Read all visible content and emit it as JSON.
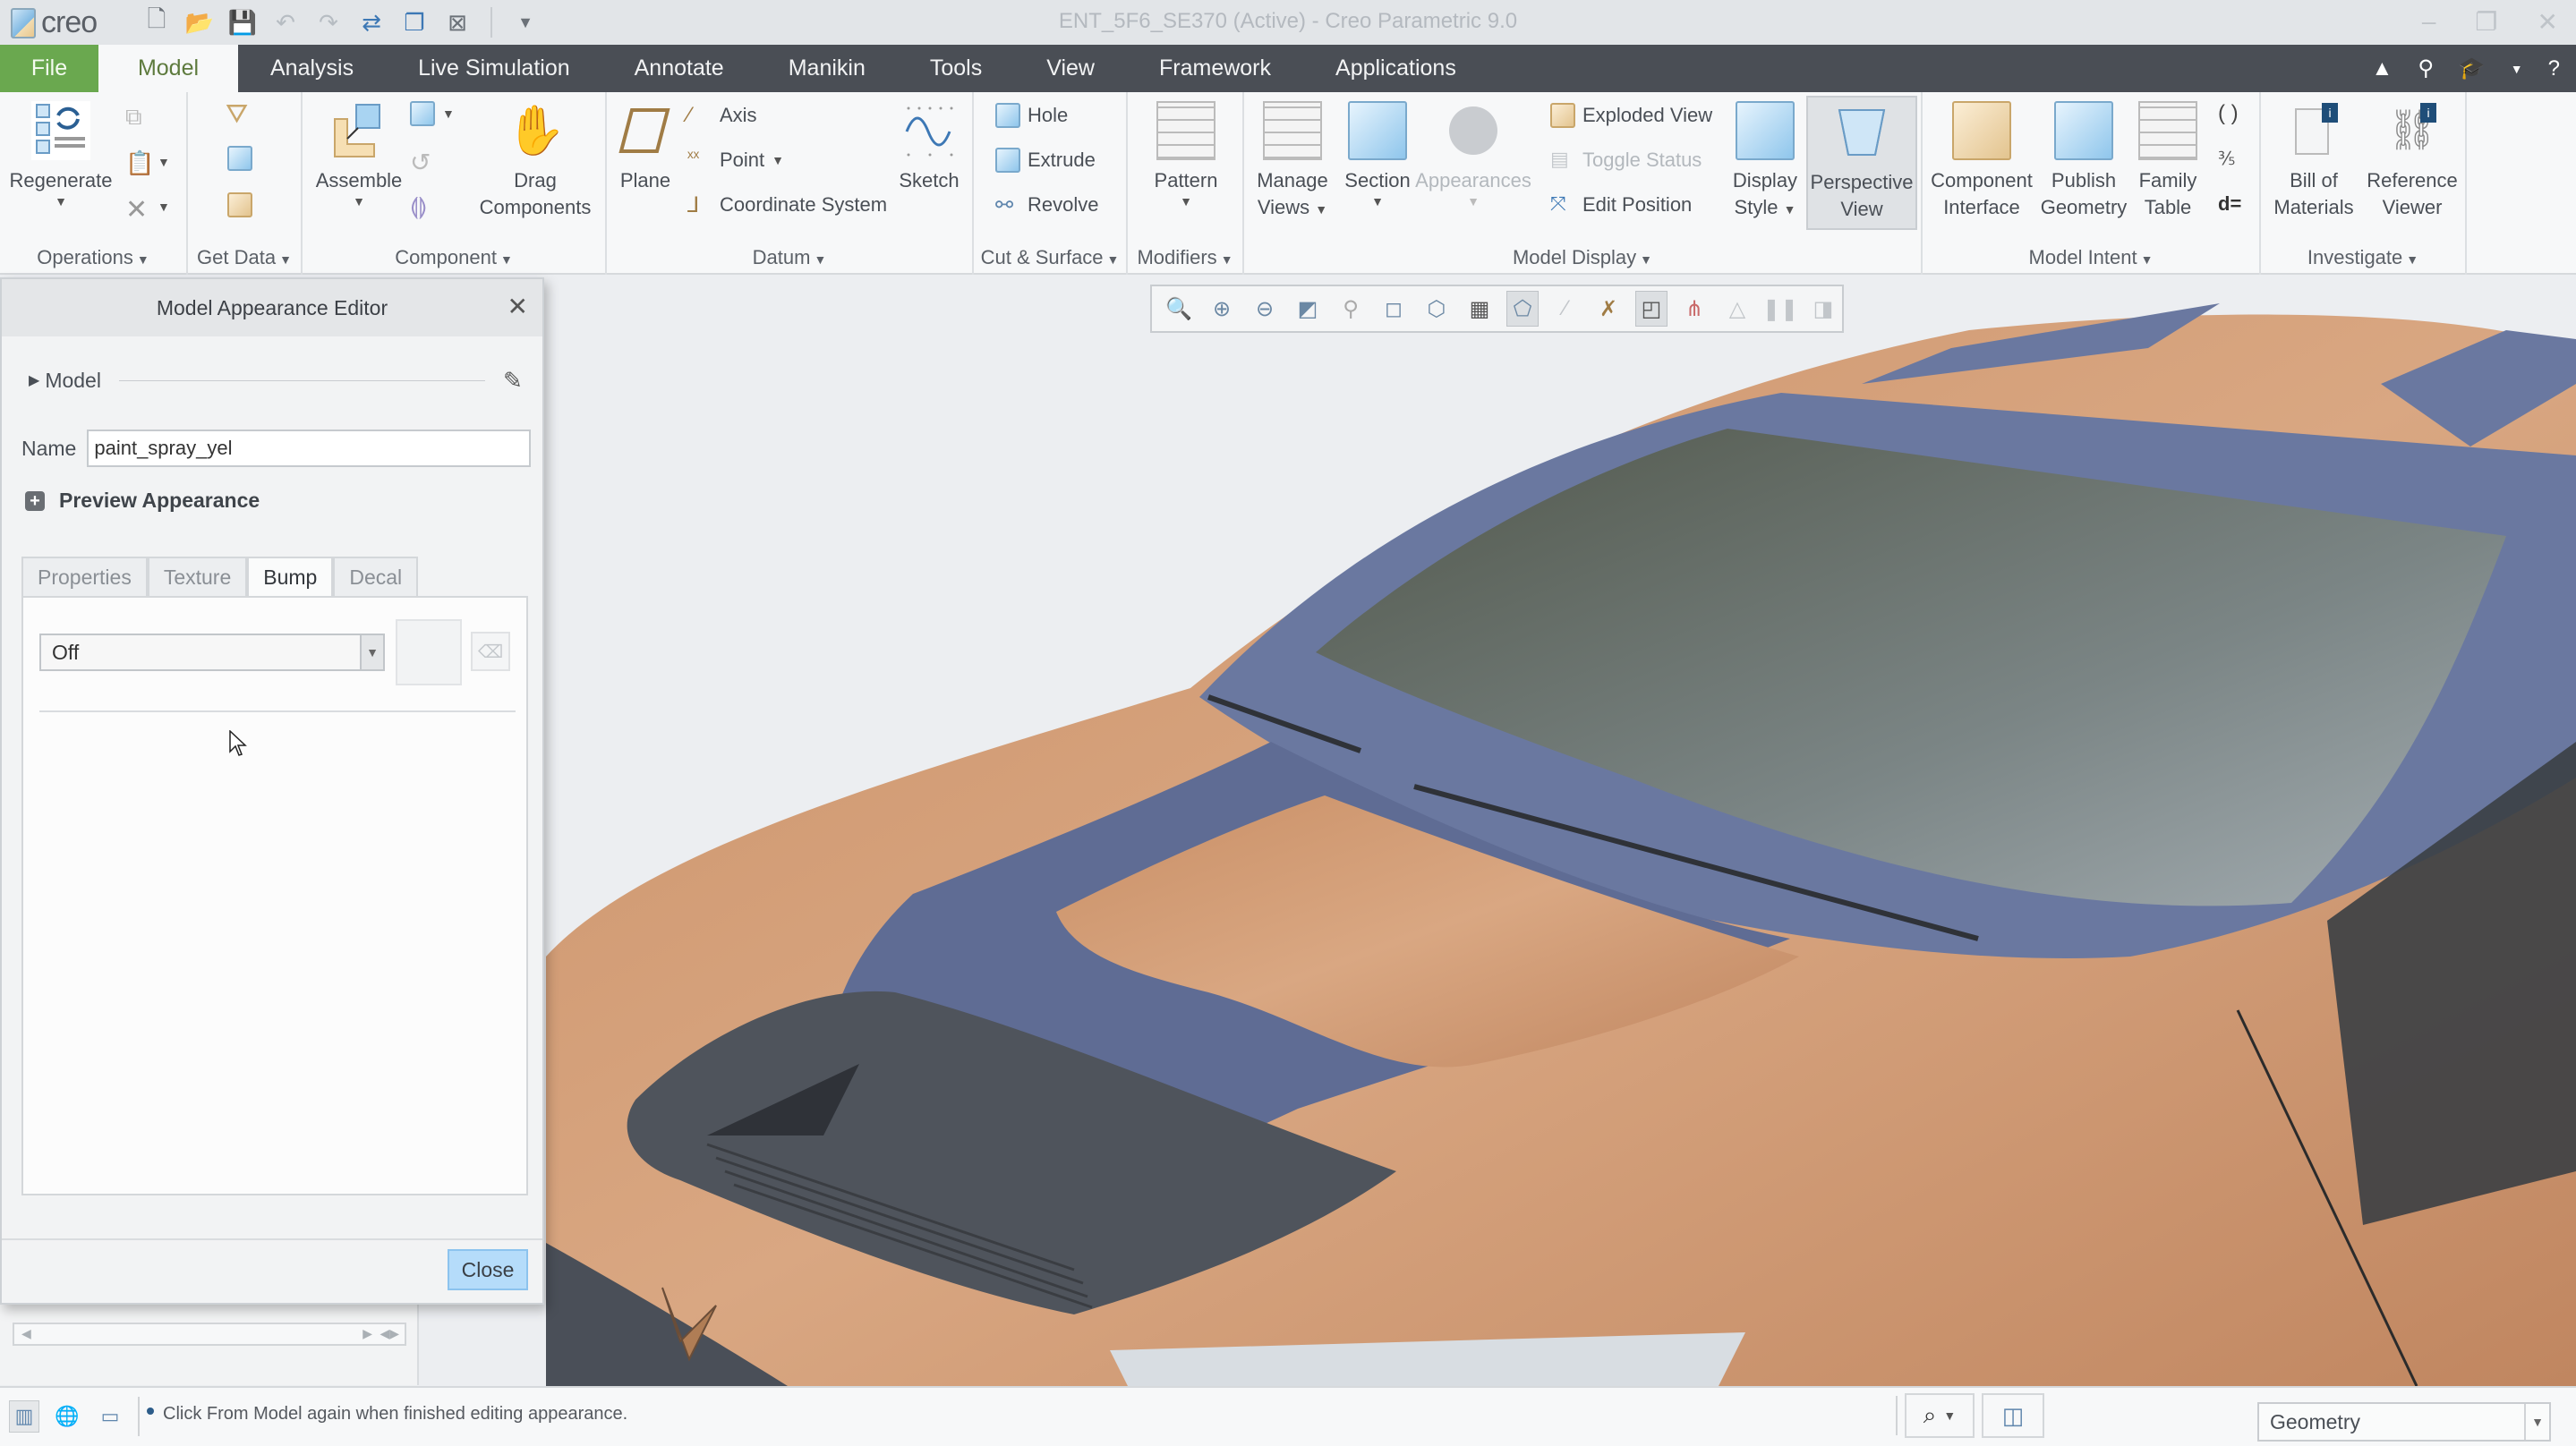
{
  "window": {
    "app_name": "creo",
    "title": "ENT_5F6_SE370 (Active) - Creo Parametric 9.0"
  },
  "quick_access": [
    {
      "icon": "new-file-icon"
    },
    {
      "icon": "open-folder-icon"
    },
    {
      "icon": "save-icon"
    },
    {
      "icon": "undo-icon"
    },
    {
      "icon": "redo-icon"
    },
    {
      "icon": "regenerate-icon"
    },
    {
      "icon": "windows-icon"
    },
    {
      "icon": "close-window-icon"
    },
    {
      "icon": "customize-icon"
    }
  ],
  "tabs": [
    {
      "label": "File"
    },
    {
      "label": "Model",
      "active": true
    },
    {
      "label": "Analysis"
    },
    {
      "label": "Live Simulation"
    },
    {
      "label": "Annotate"
    },
    {
      "label": "Manikin"
    },
    {
      "label": "Tools"
    },
    {
      "label": "View"
    },
    {
      "label": "Framework"
    },
    {
      "label": "Applications"
    }
  ],
  "ribbon": {
    "groups": {
      "operations": "Operations",
      "get_data": "Get Data",
      "component": "Component",
      "datum": "Datum",
      "cut_surface": "Cut & Surface",
      "modifiers": "Modifiers",
      "model_display": "Model Display",
      "model_intent": "Model Intent",
      "investigate": "Investigate"
    },
    "buttons": {
      "regenerate": "Regenerate",
      "assemble": "Assemble",
      "drag_components_1": "Drag",
      "drag_components_2": "Components",
      "plane": "Plane",
      "axis": "Axis",
      "point": "Point",
      "coordinate_system": "Coordinate System",
      "sketch": "Sketch",
      "hole": "Hole",
      "extrude": "Extrude",
      "revolve": "Revolve",
      "pattern": "Pattern",
      "manage_views_1": "Manage",
      "manage_views_2": "Views",
      "section": "Section",
      "appearances": "Appearances",
      "exploded_view": "Exploded View",
      "toggle_status": "Toggle Status",
      "edit_position": "Edit Position",
      "display_style_1": "Display",
      "display_style_2": "Style",
      "perspective_view_1": "Perspective",
      "perspective_view_2": "View",
      "component_interface_1": "Component",
      "component_interface_2": "Interface",
      "publish_geometry_1": "Publish",
      "publish_geometry_2": "Geometry",
      "family_table_1": "Family",
      "family_table_2": "Table",
      "bill_of_materials_1": "Bill of",
      "bill_of_materials_2": "Materials",
      "reference_viewer_1": "Reference",
      "reference_viewer_2": "Viewer"
    }
  },
  "graphics_toolbar": [
    {
      "icon": "refit-icon"
    },
    {
      "icon": "zoom-in-icon"
    },
    {
      "icon": "zoom-out-icon"
    },
    {
      "icon": "repaint-icon"
    },
    {
      "icon": "spin-center-icon"
    },
    {
      "icon": "display-style-icon"
    },
    {
      "icon": "saved-orientations-icon"
    },
    {
      "icon": "view-manager-icon"
    },
    {
      "icon": "perspective-icon",
      "active": true
    },
    {
      "icon": "datum-display-icon"
    },
    {
      "icon": "annotation-display-icon"
    },
    {
      "icon": "appearance-editor-icon",
      "active": true
    },
    {
      "icon": "connect-icon"
    },
    {
      "icon": "simulation-icon"
    },
    {
      "icon": "pause-icon"
    },
    {
      "icon": "stop-icon"
    }
  ],
  "dialog": {
    "title": "Model Appearance Editor",
    "model_label": "Model",
    "name_label": "Name",
    "name_value": "paint_spray_yel",
    "preview_label": "Preview Appearance",
    "tabs": [
      "Properties",
      "Texture",
      "Bump",
      "Decal"
    ],
    "active_tab": "Bump",
    "bump_mode": "Off",
    "close_label": "Close"
  },
  "statusbar": {
    "message": "Click From Model again when finished editing appearance.",
    "filter_value": "Geometry"
  },
  "colors": {
    "file_tab": "#6aa84f",
    "tab_bar": "#4a4e55",
    "body_paint": "#d4a27c",
    "stripe_blue": "#6a78a0",
    "close_button": "#b5dcfa"
  }
}
